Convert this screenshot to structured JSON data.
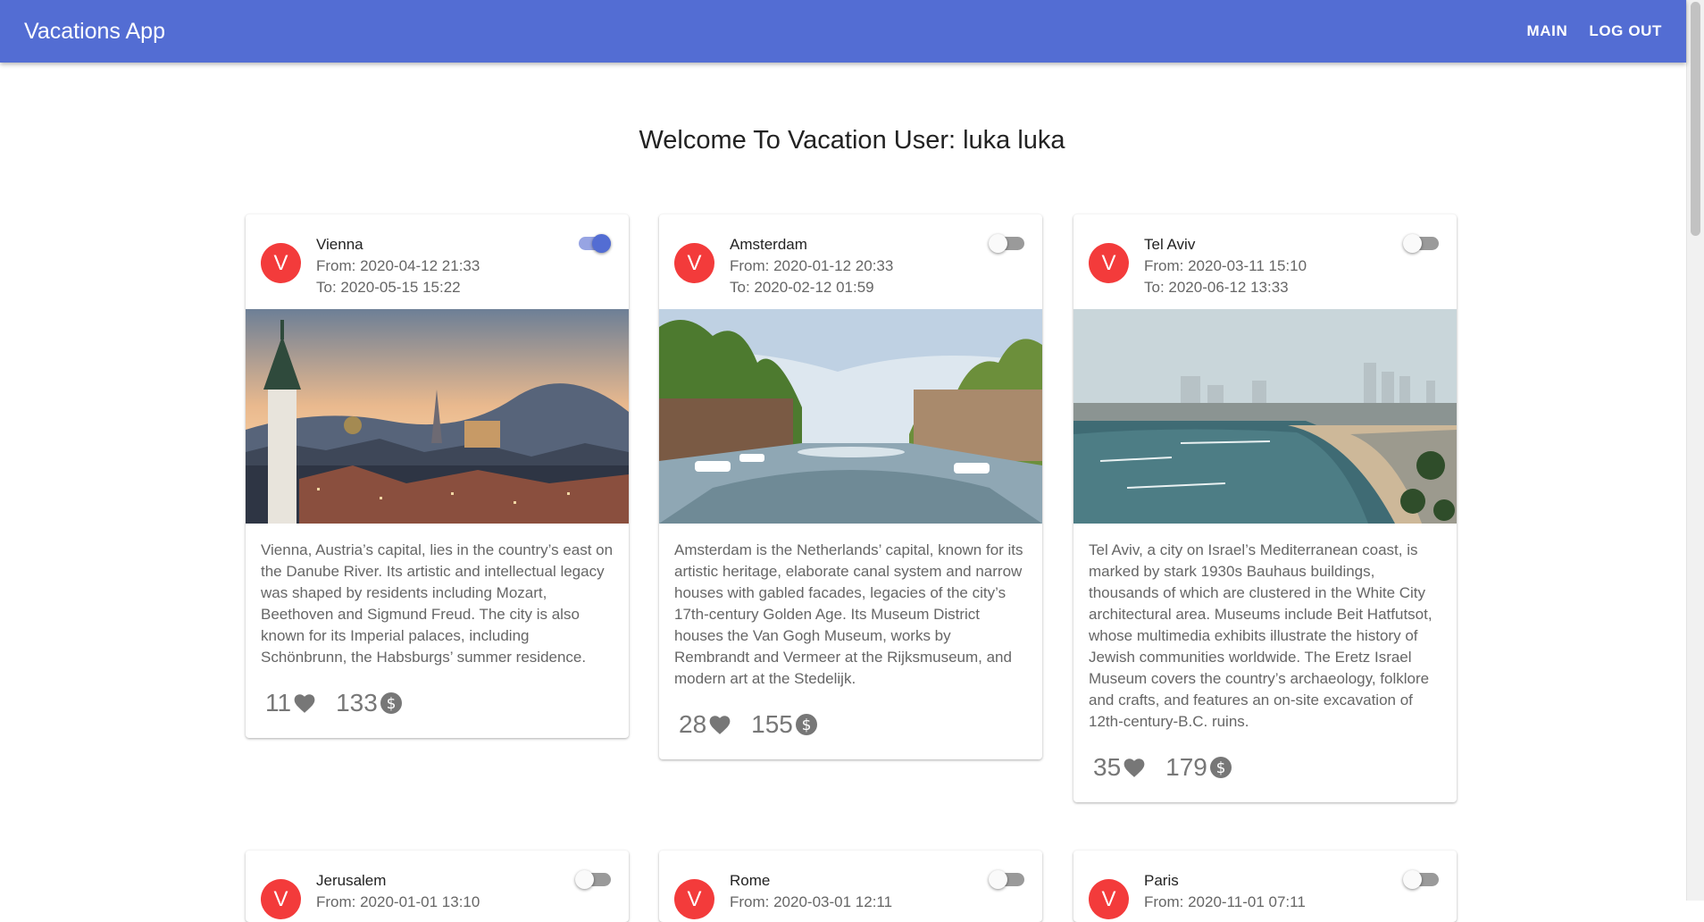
{
  "app": {
    "title": "Vacations App"
  },
  "nav": {
    "main": "MAIN",
    "logout": "LOG OUT"
  },
  "welcome": "Welcome To Vacation User: luka luka",
  "vacations": [
    {
      "avatar": "V",
      "city": "Vienna",
      "from": "From: 2020-04-12 21:33",
      "to": "To: 2020-05-15 15:22",
      "followed": true,
      "description": "Vienna, Austria’s capital, lies in the country’s east on the Danube River. Its artistic and intellectual legacy was shaped by residents including Mozart, Beethoven and Sigmund Freud. The city is also known for its Imperial palaces, including Schönbrunn, the Habsburgs’ summer residence.",
      "followers": "11",
      "price": "133"
    },
    {
      "avatar": "V",
      "city": "Amsterdam",
      "from": "From: 2020-01-12 20:33",
      "to": "To: 2020-02-12 01:59",
      "followed": false,
      "description": "Amsterdam is the Netherlands’ capital, known for its artistic heritage, elaborate canal system and narrow houses with gabled facades, legacies of the city’s 17th-century Golden Age. Its Museum District houses the Van Gogh Museum, works by Rembrandt and Vermeer at the Rijksmuseum, and modern art at the Stedelijk.",
      "followers": "28",
      "price": "155"
    },
    {
      "avatar": "V",
      "city": "Tel Aviv",
      "from": "From: 2020-03-11 15:10",
      "to": "To: 2020-06-12 13:33",
      "followed": false,
      "description": "Tel Aviv, a city on Israel’s Mediterranean coast, is marked by stark 1930s Bauhaus buildings, thousands of which are clustered in the White City architectural area. Museums include Beit Hatfutsot, whose multimedia exhibits illustrate the history of Jewish communities worldwide. The Eretz Israel Museum covers the country’s archaeology, folklore and crafts, and features an on-site excavation of 12th-century-B.C. ruins.",
      "followers": "35",
      "price": "179"
    },
    {
      "avatar": "V",
      "city": "Jerusalem",
      "from": "From: 2020-01-01 13:10",
      "followed": false
    },
    {
      "avatar": "V",
      "city": "Rome",
      "from": "From: 2020-03-01 12:11",
      "followed": false
    },
    {
      "avatar": "V",
      "city": "Paris",
      "from": "From: 2020-11-01 07:11",
      "followed": false
    }
  ],
  "icons": {
    "follow": "heart-icon",
    "price": "dollar-circle-icon"
  },
  "colors": {
    "appbar": "#536dd3",
    "avatar": "#f33b3b",
    "toggle_on": "#536dd3"
  }
}
